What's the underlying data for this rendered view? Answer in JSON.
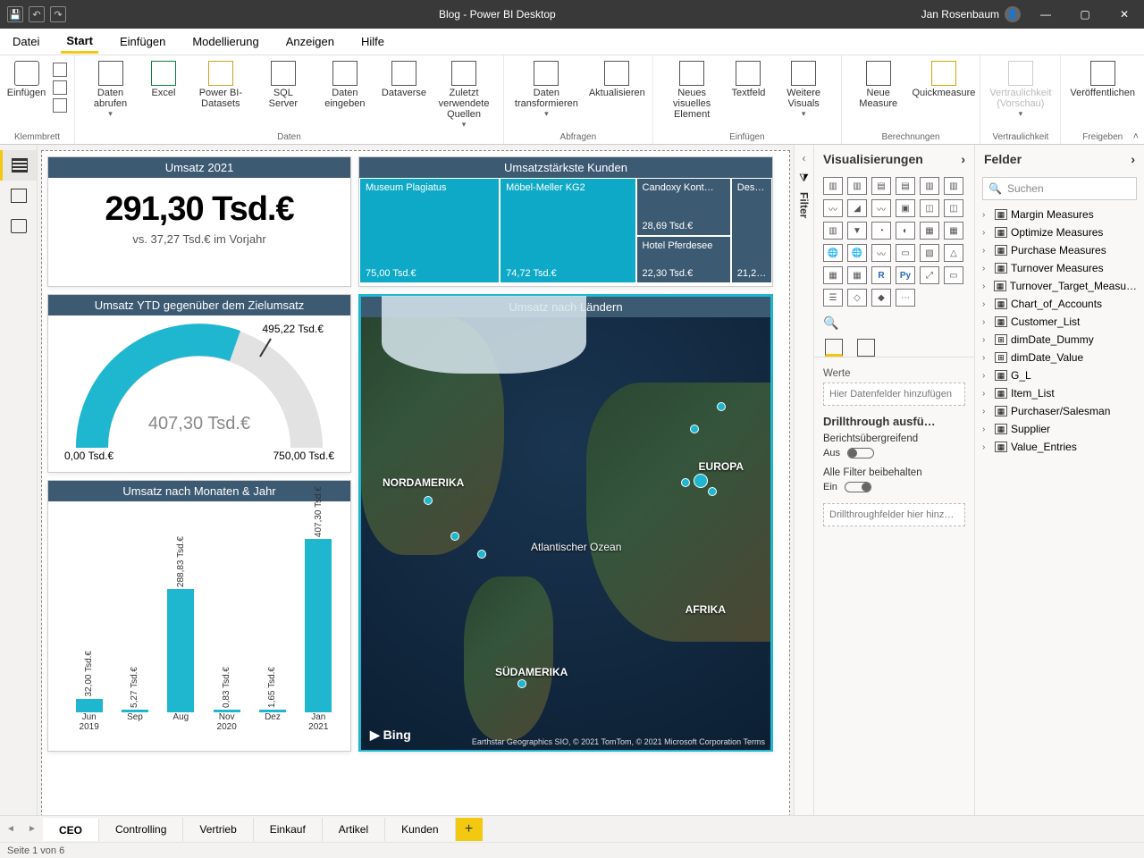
{
  "app_title": "Blog - Power BI Desktop",
  "user_name": "Jan Rosenbaum",
  "menus": [
    "Datei",
    "Start",
    "Einfügen",
    "Modellierung",
    "Anzeigen",
    "Hilfe"
  ],
  "active_menu": "Start",
  "ribbon": {
    "groups": {
      "clipboard": "Klemmbrett",
      "data": "Daten",
      "queries": "Abfragen",
      "insert": "Einfügen",
      "calc": "Berechnungen",
      "sens": "Vertraulichkeit",
      "share": "Freigeben"
    },
    "buttons": {
      "paste": "Einfügen",
      "getdata": "Daten abrufen",
      "excel": "Excel",
      "pbids": "Power BI-Datasets",
      "sql": "SQL Server",
      "enter": "Daten eingeben",
      "dataverse": "Dataverse",
      "recent": "Zuletzt verwendete Quellen",
      "transform": "Daten transformieren",
      "refresh": "Aktualisieren",
      "newvis": "Neues visuelles Element",
      "textbox": "Textfeld",
      "morevis": "Weitere Visuals",
      "measure": "Neue Measure",
      "quick": "Quickmeasure",
      "sensitivity": "Vertraulichkeit (Vorschau)",
      "publish": "Veröffentlichen"
    }
  },
  "leftrail": {
    "report": "report",
    "data": "data",
    "model": "model"
  },
  "tiles": {
    "kpi": {
      "title": "Umsatz 2021",
      "value": "291,30 Tsd.€",
      "subtitle": "vs. 37,27 Tsd.€ im Vorjahr"
    },
    "treemap": {
      "title": "Umsatzstärkste Kunden",
      "cells": [
        {
          "name": "Museum Plagiatus",
          "value": "75,00 Tsd.€"
        },
        {
          "name": "Möbel-Meller KG2",
          "value": "74,72 Tsd.€"
        },
        {
          "name": "Candoxy Kont…",
          "value": "28,69 Tsd.€"
        },
        {
          "name": "Hotel Pferdesee",
          "value": "22,30 Tsd.€"
        },
        {
          "name": "Des…",
          "value": "21,2…"
        }
      ]
    },
    "gauge": {
      "title": "Umsatz YTD gegenüber dem Zielumsatz",
      "center": "407,30 Tsd.€",
      "min": "0,00 Tsd.€",
      "max": "750,00 Tsd.€",
      "target": "495,22 Tsd.€"
    },
    "bars": {
      "title": "Umsatz nach Monaten & Jahr"
    },
    "map": {
      "title": "Umsatz nach Ländern",
      "labels": {
        "na": "NORDAMERIKA",
        "eu": "EUROPA",
        "af": "AFRIKA",
        "sa": "SÜDAMERIKA",
        "ao": "Atlantischer Ozean"
      },
      "bing": "Bing",
      "attribution": "Earthstar Geographics SIO, © 2021 TomTom, © 2021 Microsoft Corporation  Terms"
    }
  },
  "chart_data": {
    "type": "bar",
    "title": "Umsatz nach Monaten & Jahr",
    "ylabel": "Tsd.€",
    "categories_month": [
      "Jun",
      "Sep",
      "Aug",
      "Nov",
      "Dez",
      "Jan"
    ],
    "categories_year": [
      "2019",
      "",
      "",
      "2020",
      "",
      "2021"
    ],
    "values": [
      32.0,
      5.27,
      288.83,
      0.83,
      1.65,
      407.3
    ],
    "value_labels": [
      "32,00 Tsd.€",
      "5,27 Tsd.€",
      "288,83 Tsd.€",
      "0,83 Tsd.€",
      "1,65 Tsd.€",
      "407,30 Tsd.€"
    ],
    "ylim": [
      0,
      420
    ]
  },
  "filter_label": "Filter",
  "vizpane": {
    "title": "Visualisierungen",
    "werte": "Werte",
    "drop_fields": "Hier Datenfelder hinzufügen",
    "drill_title": "Drillthrough ausfü…",
    "cross": "Berichtsübergreifend",
    "cross_state": "Aus",
    "keepall": "Alle Filter beibehalten",
    "keepall_state": "Ein",
    "drill_drop": "Drillthroughfelder hier hinz…"
  },
  "fieldpane": {
    "title": "Felder",
    "search_placeholder": "Suchen",
    "tables": [
      {
        "icon": "▦",
        "name": "Margin Measures"
      },
      {
        "icon": "▦",
        "name": "Optimize Measures"
      },
      {
        "icon": "▦",
        "name": "Purchase Measures"
      },
      {
        "icon": "▦",
        "name": "Turnover Measures"
      },
      {
        "icon": "▦",
        "name": "Turnover_Target_Measu…"
      },
      {
        "icon": "▦",
        "name": "Chart_of_Accounts"
      },
      {
        "icon": "▦",
        "name": "Customer_List"
      },
      {
        "icon": "⊞",
        "name": "dimDate_Dummy"
      },
      {
        "icon": "⊞",
        "name": "dimDate_Value"
      },
      {
        "icon": "▦",
        "name": "G_L"
      },
      {
        "icon": "▦",
        "name": "Item_List"
      },
      {
        "icon": "▦",
        "name": "Purchaser/Salesman"
      },
      {
        "icon": "▦",
        "name": "Supplier"
      },
      {
        "icon": "▦",
        "name": "Value_Entries"
      }
    ]
  },
  "pagetabs": [
    "CEO",
    "Controlling",
    "Vertrieb",
    "Einkauf",
    "Artikel",
    "Kunden"
  ],
  "active_pagetab": "CEO",
  "status": "Seite 1 von 6"
}
